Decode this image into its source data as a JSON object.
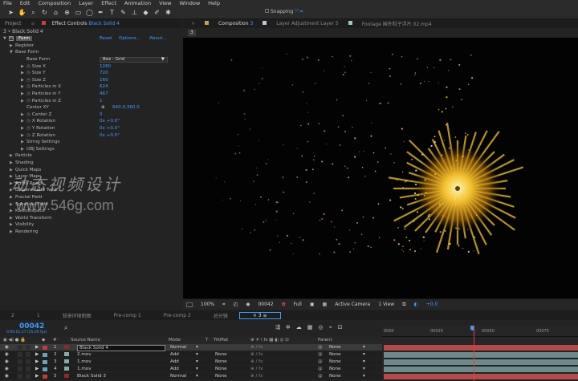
{
  "menu": [
    "File",
    "Edit",
    "Composition",
    "Layer",
    "Effect",
    "Animation",
    "View",
    "Window",
    "Help"
  ],
  "toolbar": {
    "snapping_label": "Snapping"
  },
  "left_tabs": {
    "project": "Project",
    "effect_controls": "Effect Controls",
    "effect_layer": "Black Solid 4"
  },
  "effect_header": "3 • Black Solid 4",
  "effect": {
    "name": "Form",
    "reset": "Reset",
    "options": "Options...",
    "about": "About..."
  },
  "effect_rows": [
    {
      "indent": 0,
      "tri": "▶",
      "label": "Register",
      "value": ""
    },
    {
      "indent": 0,
      "tri": "▼",
      "label": "Base Form",
      "value": ""
    },
    {
      "indent": 1,
      "tri": "",
      "label": "Base Form",
      "value": "Box - Grid",
      "dropdown": true
    },
    {
      "indent": 1,
      "tri": "▶",
      "label": "Size X",
      "value": "1280"
    },
    {
      "indent": 1,
      "tri": "▶",
      "label": "Size Y",
      "value": "720"
    },
    {
      "indent": 1,
      "tri": "▶",
      "label": "Size Z",
      "value": "160"
    },
    {
      "indent": 1,
      "tri": "▶",
      "label": "Particles in X",
      "value": "624"
    },
    {
      "indent": 1,
      "tri": "▶",
      "label": "Particles in Y",
      "value": "467"
    },
    {
      "indent": 1,
      "tri": "▶",
      "label": "Particles in Z",
      "value": "1"
    },
    {
      "indent": 1,
      "tri": "",
      "label": "Center XY",
      "value": "640.0,360.0",
      "target": true
    },
    {
      "indent": 1,
      "tri": "▶",
      "label": "Center Z",
      "value": "0"
    },
    {
      "indent": 1,
      "tri": "▶",
      "label": "X Rotation",
      "value": "0x +0.0°"
    },
    {
      "indent": 1,
      "tri": "▶",
      "label": "Y Rotation",
      "value": "0x +0.0°"
    },
    {
      "indent": 1,
      "tri": "▶",
      "label": "Z Rotation",
      "value": "0x +0.0°"
    },
    {
      "indent": 1,
      "tri": "▶",
      "label": "String Settings",
      "value": ""
    },
    {
      "indent": 1,
      "tri": "▶",
      "label": "OBJ Settings",
      "value": ""
    },
    {
      "indent": 0,
      "tri": "▶",
      "label": "Particle",
      "value": ""
    },
    {
      "indent": 0,
      "tri": "▶",
      "label": "Shading",
      "value": ""
    },
    {
      "indent": 0,
      "tri": "▶",
      "label": "Quick Maps",
      "value": ""
    },
    {
      "indent": 0,
      "tri": "▶",
      "label": "Layer Maps",
      "value": ""
    },
    {
      "indent": 0,
      "tri": "▶",
      "label": "Audio React",
      "value": ""
    },
    {
      "indent": 0,
      "tri": "▶",
      "label": "Disperse and Twist",
      "value": ""
    },
    {
      "indent": 0,
      "tri": "▶",
      "label": "Fractal Field",
      "value": ""
    },
    {
      "indent": 0,
      "tri": "▶",
      "label": "Spherical Field",
      "value": ""
    },
    {
      "indent": 0,
      "tri": "▶",
      "label": "Kaleidospace",
      "value": ""
    },
    {
      "indent": 0,
      "tri": "▶",
      "label": "World Transform",
      "value": ""
    },
    {
      "indent": 0,
      "tri": "▶",
      "label": "Visibility",
      "value": ""
    },
    {
      "indent": 0,
      "tri": "▶",
      "label": "Rendering",
      "value": ""
    }
  ],
  "viewer_tabs": {
    "composition": "Composition",
    "comp_num": "3",
    "layer": "Layer Adjustment Layer 5",
    "footage": "Footage 国外粒子浮片 02.mp4"
  },
  "viewer_tag": "3",
  "watermark": {
    "line1": "动态视频设计",
    "line2": "www.546g.com"
  },
  "viewer_footer": {
    "zoom": "100%",
    "timecode": "00042",
    "resolution": "Full",
    "camera": "Active Camera",
    "views": "1 View",
    "exposure": "+0.0"
  },
  "timeline_tabs": [
    "2",
    "1",
    "背景环境制图",
    "Pre-comp 1",
    "Pre-comp 2",
    "总分镜",
    "3"
  ],
  "timeline": {
    "timecode": "00042",
    "fps": "0:00:01:17 (25.00 fps)"
  },
  "columns": {
    "source": "Source Name",
    "mode": "Mode",
    "t": "T",
    "trkmat": "TrkMat",
    "parent": "Parent"
  },
  "ruler_ticks": [
    "0000",
    "00025",
    "00050",
    "00075"
  ],
  "layers": [
    {
      "num": "1",
      "name": "Black Solid 4",
      "mode": "Normal",
      "trkmat": "",
      "parent": "None",
      "color": "#c23b3b",
      "selected": true
    },
    {
      "num": "2",
      "name": "2.mov",
      "mode": "Add",
      "trkmat": "None",
      "parent": "None",
      "color": "#6fa0b8",
      "selected": false
    },
    {
      "num": "3",
      "name": "1.mov",
      "mode": "Add",
      "trkmat": "None",
      "parent": "None",
      "color": "#6fa0b8",
      "selected": false
    },
    {
      "num": "4",
      "name": "1.mov",
      "mode": "Add",
      "trkmat": "None",
      "parent": "None",
      "color": "#6fa0b8",
      "selected": false
    },
    {
      "num": "5",
      "name": "Black Solid 3",
      "mode": "Normal",
      "trkmat": "None",
      "parent": "None",
      "color": "#c23b3b",
      "selected": false
    }
  ],
  "colors": {
    "accent": "#3f9cff",
    "solid_track": "#b54a4a",
    "footage_track": "#6e8a8a",
    "particle": "#f2c12e"
  }
}
